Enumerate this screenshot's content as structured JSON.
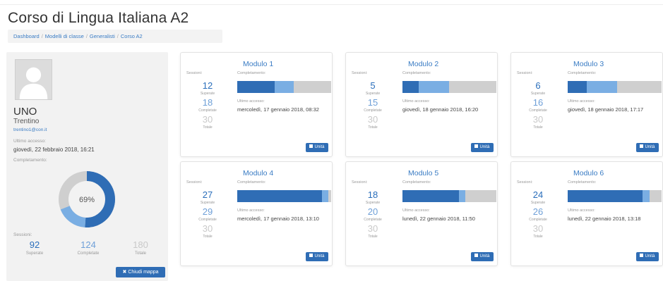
{
  "page": {
    "title": "Corso di Lingua Italiana A2"
  },
  "breadcrumb": [
    "Dashboard",
    "Modelli di classe",
    "Generalisti",
    "Corso A2"
  ],
  "profile": {
    "name": "UNO",
    "city": "Trentino",
    "email": "trentino1@con.it",
    "last_access_label": "Ultimo accesso:",
    "last_access": "giovedì, 22 febbraio 2018, 16:21",
    "completion_label": "Completamento:",
    "completion_percent": "69%",
    "completion_fraction": {
      "superate": 0.51,
      "completate": 0.18
    },
    "sessions_label": "Sessioni:",
    "stats": [
      {
        "num": "92",
        "label": "Superate"
      },
      {
        "num": "124",
        "label": "Completate"
      },
      {
        "num": "180",
        "label": "Totale"
      }
    ],
    "close_button": "Chiudi mappa"
  },
  "labels": {
    "sessions": "Sessioni:",
    "completion": "Completamento:",
    "last_access": "Ultimo accesso:",
    "superate": "Superate",
    "completate": "Completate",
    "totale": "Totale",
    "unit_button": "Unità"
  },
  "modules": [
    {
      "title": "Modulo 1",
      "superate": "12",
      "completate": "18",
      "totale": "30",
      "last_access": "mercoledì, 17 gennaio 2018, 08:32",
      "progress": {
        "superate": 0.4,
        "completate": 0.2
      }
    },
    {
      "title": "Modulo 2",
      "superate": "5",
      "completate": "15",
      "totale": "30",
      "last_access": "giovedì, 18 gennaio 2018, 16:20",
      "progress": {
        "superate": 0.17,
        "completate": 0.33
      }
    },
    {
      "title": "Modulo 3",
      "superate": "6",
      "completate": "16",
      "totale": "30",
      "last_access": "giovedì, 18 gennaio 2018, 17:17",
      "progress": {
        "superate": 0.2,
        "completate": 0.33
      }
    },
    {
      "title": "Modulo 4",
      "superate": "27",
      "completate": "29",
      "totale": "30",
      "last_access": "mercoledì, 17 gennaio 2018, 13:10",
      "progress": {
        "superate": 0.9,
        "completate": 0.07
      }
    },
    {
      "title": "Modulo 5",
      "superate": "18",
      "completate": "20",
      "totale": "30",
      "last_access": "lunedì, 22 gennaio 2018, 11:50",
      "progress": {
        "superate": 0.6,
        "completate": 0.07
      }
    },
    {
      "title": "Modulo 6",
      "superate": "24",
      "completate": "26",
      "totale": "30",
      "last_access": "lunedì, 22 gennaio 2018, 13:18",
      "progress": {
        "superate": 0.8,
        "completate": 0.07
      }
    }
  ],
  "colors": {
    "superate": "#2f6db5",
    "completate": "#7aaee3",
    "totale": "#cfcfcf",
    "link": "#3a7cc4"
  }
}
